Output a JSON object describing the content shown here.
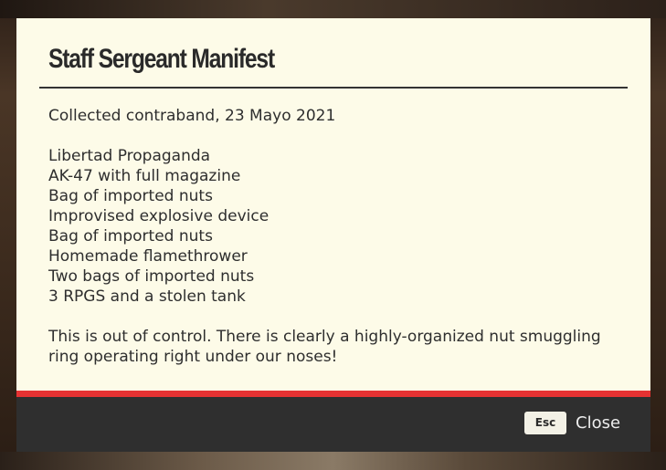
{
  "dialog": {
    "title": "Staff Sergeant Manifest",
    "intro": "Collected contraband, 23 Mayo 2021",
    "items": [
      "Libertad Propaganda",
      "AK-47 with full magazine",
      "Bag of imported nuts",
      "Improvised explosive device",
      "Bag of imported nuts",
      "Homemade flamethrower",
      "Two bags of imported nuts",
      "3 RPGS and a stolen tank"
    ],
    "closing_line_1": "This is out of control. There is clearly a highly-organized nut smuggling",
    "closing_line_2": "ring operating right under our noses!"
  },
  "footer": {
    "key_label": "Esc",
    "close_label": "Close"
  },
  "colors": {
    "paper": "#fdfbe8",
    "accent_red": "#e63232",
    "footer_bg": "#2f2f2f"
  }
}
